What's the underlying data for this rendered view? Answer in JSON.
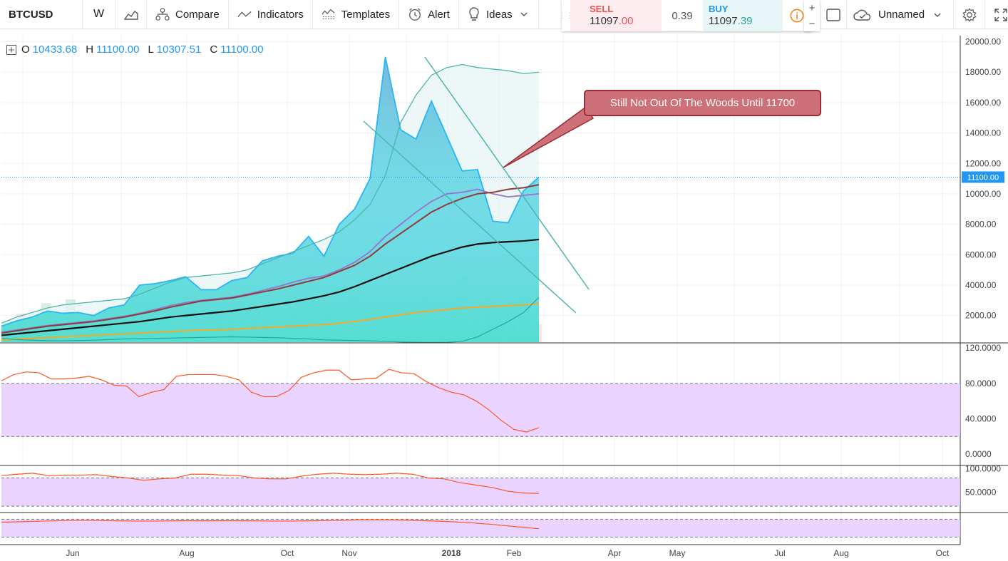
{
  "toolbar": {
    "symbol": "BTCUSD",
    "interval": "W",
    "compare": "Compare",
    "indicators": "Indicators",
    "templates": "Templates",
    "alert": "Alert",
    "ideas": "Ideas",
    "layout_name": "Unnamed"
  },
  "trade": {
    "sell_label": "SELL",
    "sell_price_main": "11097",
    "sell_price_tail": ".00",
    "spread": "0.39",
    "buy_label": "BUY",
    "buy_price_main": "11097",
    "buy_price_tail": ".39"
  },
  "ohlc": {
    "o_label": "O",
    "o": "10433.68",
    "h_label": "H",
    "h": "11100.00",
    "l_label": "L",
    "l": "10307.51",
    "c_label": "C",
    "c": "11100.00"
  },
  "annotation": "Still Not Out Of The Woods Until 11700",
  "colors": {
    "accent": "#2196f3",
    "sell": "#ef5350",
    "buy": "#26a69a",
    "band": "#e6ccff",
    "rsi_line": "#ff5722"
  },
  "chart_data": [
    {
      "type": "line",
      "title": "BTCUSD",
      "interval": "W",
      "x_labels": [
        "Jun",
        "Aug",
        "Oct",
        "Nov",
        "2018",
        "Feb",
        "Apr",
        "May",
        "Jul",
        "Aug",
        "Oct"
      ],
      "y_ticks": [
        "20000.00",
        "18000.00",
        "16000.00",
        "14000.00",
        "12000.00",
        "10000.00",
        "8000.00",
        "6000.00",
        "4000.00",
        "2000.00"
      ],
      "ylim": [
        250,
        20400
      ],
      "last_price_label": "11100.00",
      "last_price": 11100,
      "series": [
        {
          "color": "#29b6f6",
          "values": [
            1300,
            1650,
            1900,
            2300,
            2150,
            2200,
            2000,
            2500,
            2700,
            4000,
            4100,
            4300,
            4550,
            3700,
            3700,
            4300,
            4500,
            5600,
            5900,
            6100,
            7200,
            5900,
            8000,
            9000,
            11000,
            19000,
            14200,
            13600,
            16100,
            13800,
            11500,
            11600,
            8200,
            8100,
            10200,
            11100
          ]
        },
        {
          "color": "#4db6ac",
          "values": [
            1500,
            1900,
            2200,
            2500,
            2700,
            2800,
            2900,
            3000,
            3100,
            3400,
            3800,
            4200,
            4500,
            4600,
            4700,
            4800,
            5000,
            5400,
            5800,
            6200,
            6600,
            7000,
            7500,
            8300,
            9300,
            11200,
            14700,
            16500,
            17800,
            18300,
            18500,
            18300,
            18200,
            18100,
            17900,
            18000
          ]
        },
        {
          "color": "#9575cd",
          "values": [
            900,
            1050,
            1200,
            1350,
            1450,
            1550,
            1650,
            1800,
            1950,
            2150,
            2400,
            2650,
            2850,
            3000,
            3100,
            3200,
            3400,
            3650,
            3900,
            4200,
            4450,
            4600,
            5000,
            5500,
            6200,
            7200,
            8000,
            8800,
            9500,
            10000,
            10100,
            10300,
            10000,
            9800,
            9900,
            10000
          ]
        },
        {
          "color": "#8d3b3b",
          "values": [
            850,
            1000,
            1150,
            1300,
            1400,
            1500,
            1600,
            1750,
            1900,
            2100,
            2300,
            2550,
            2750,
            2950,
            3050,
            3150,
            3350,
            3550,
            3750,
            4000,
            4250,
            4500,
            4900,
            5300,
            5900,
            6700,
            7400,
            8100,
            8800,
            9300,
            9700,
            10000,
            10100,
            10300,
            10400,
            10600
          ]
        },
        {
          "color": "#111111",
          "values": [
            700,
            800,
            900,
            1000,
            1100,
            1200,
            1300,
            1400,
            1500,
            1600,
            1750,
            1900,
            2000,
            2100,
            2200,
            2300,
            2450,
            2600,
            2750,
            2900,
            3100,
            3300,
            3550,
            3900,
            4300,
            4700,
            5100,
            5500,
            5900,
            6200,
            6500,
            6700,
            6800,
            6850,
            6900,
            7000
          ]
        },
        {
          "color": "#f9a825",
          "values": [
            400,
            450,
            500,
            550,
            600,
            650,
            700,
            750,
            800,
            850,
            900,
            950,
            1000,
            1050,
            1050,
            1100,
            1150,
            1200,
            1250,
            1300,
            1350,
            1400,
            1500,
            1600,
            1750,
            1900,
            2050,
            2200,
            2300,
            2400,
            2500,
            2550,
            2600,
            2650,
            2700,
            2800
          ]
        }
      ]
    },
    {
      "type": "line",
      "y_ticks": [
        "120.0000",
        "80.0000",
        "40.0000",
        "0.0000"
      ],
      "ylim": [
        -12,
        125
      ],
      "band": [
        20,
        80
      ],
      "values": [
        83,
        90,
        93,
        92,
        85,
        85,
        86,
        88,
        84,
        78,
        77,
        65,
        70,
        73,
        88,
        90,
        90,
        90,
        88,
        84,
        70,
        65,
        65,
        72,
        87,
        92,
        95,
        95,
        84,
        85,
        86,
        96,
        92,
        91,
        82,
        75,
        70,
        67,
        60,
        50,
        38,
        28,
        25,
        30
      ]
    },
    {
      "type": "line",
      "y_ticks": [
        "100.0000",
        "50.0000"
      ],
      "ylim": [
        8,
        105
      ],
      "band": [
        20,
        80
      ],
      "values": [
        85,
        88,
        90,
        85,
        86,
        86,
        87,
        83,
        80,
        75,
        78,
        80,
        88,
        88,
        86,
        85,
        80,
        78,
        78,
        84,
        88,
        90,
        88,
        87,
        88,
        90,
        88,
        80,
        78,
        70,
        65,
        60,
        52,
        48,
        47
      ]
    },
    {
      "type": "line",
      "band": [
        20,
        80
      ],
      "values": [
        70,
        72,
        74,
        76,
        76,
        75,
        74,
        74,
        75,
        75,
        75,
        75,
        74,
        74,
        75,
        76,
        78,
        78,
        77,
        75,
        72,
        68,
        62,
        55,
        48
      ]
    }
  ]
}
